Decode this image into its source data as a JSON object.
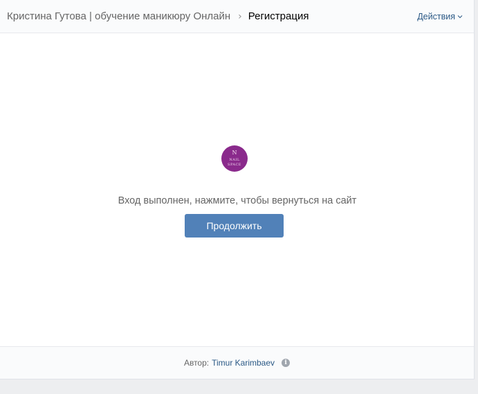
{
  "header": {
    "breadcrumb_parent": "Кристина Гутова | обучение маникюру Онлайн",
    "breadcrumb_separator": "›",
    "breadcrumb_current": "Регистрация",
    "actions_label": "Действия"
  },
  "main": {
    "logo": {
      "text_top": "N",
      "text_mid": "NAIL",
      "text_bottom": "SPACE",
      "background": "#8a2a8c"
    },
    "message": "Вход выполнен, нажмите, чтобы вернуться на сайт",
    "continue_label": "Продолжить"
  },
  "footer": {
    "author_prefix": "Автор:",
    "author_name": "Timur Karimbaev",
    "info_icon": "i"
  },
  "colors": {
    "accent": "#5181b8",
    "link": "#2a5885",
    "page_bg": "#edeef0"
  }
}
